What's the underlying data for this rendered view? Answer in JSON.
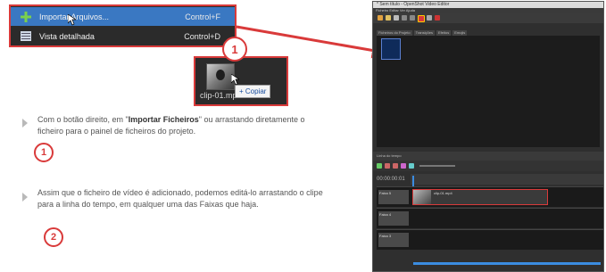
{
  "context_menu": {
    "items": [
      {
        "label": "Importar Arquivos...",
        "shortcut": "Control+F",
        "selected": true,
        "icon": "plus-icon"
      },
      {
        "label": "Vista detalhada",
        "shortcut": "Control+D",
        "selected": false,
        "icon": "detail-view-icon"
      }
    ]
  },
  "drag_preview": {
    "file_name": "clip-01.mp4",
    "copy_badge": "+ Copiar"
  },
  "callouts": {
    "one": "1",
    "two": "2"
  },
  "instructions": {
    "step1_before": "Com o botão direito, em \"",
    "step1_bold": "Importar Ficheiros",
    "step1_after": "\" ou arrastando diretamente o ficheiro para o painel de ficheiros do projeto.",
    "step2": "Assim que o ficheiro de vídeo é adicionado, podemos editá-lo arrastando o clipe para a linha do tempo, em qualquer uma das Faixas que haja."
  },
  "app_window": {
    "title": "* Sem título - OpenShot Video Editor",
    "menu": "Ficheiro  Editar  Ver  Ajuda",
    "tabs": [
      "Ficheiros do Projeto",
      "Transições",
      "Efeitos",
      "Emojis"
    ],
    "timeline_header": "Linha do tempo",
    "time_display": "00:00:00:01",
    "tracks": [
      "Faixa 5",
      "Faixa 4",
      "Faixa 3"
    ],
    "clip_name": "clip-01.mp4"
  },
  "colors": {
    "highlight_red": "#d93a3a",
    "menu_bg": "#2b2b2b",
    "selection_blue": "#3a78c2",
    "playhead_blue": "#3b8ce0"
  }
}
